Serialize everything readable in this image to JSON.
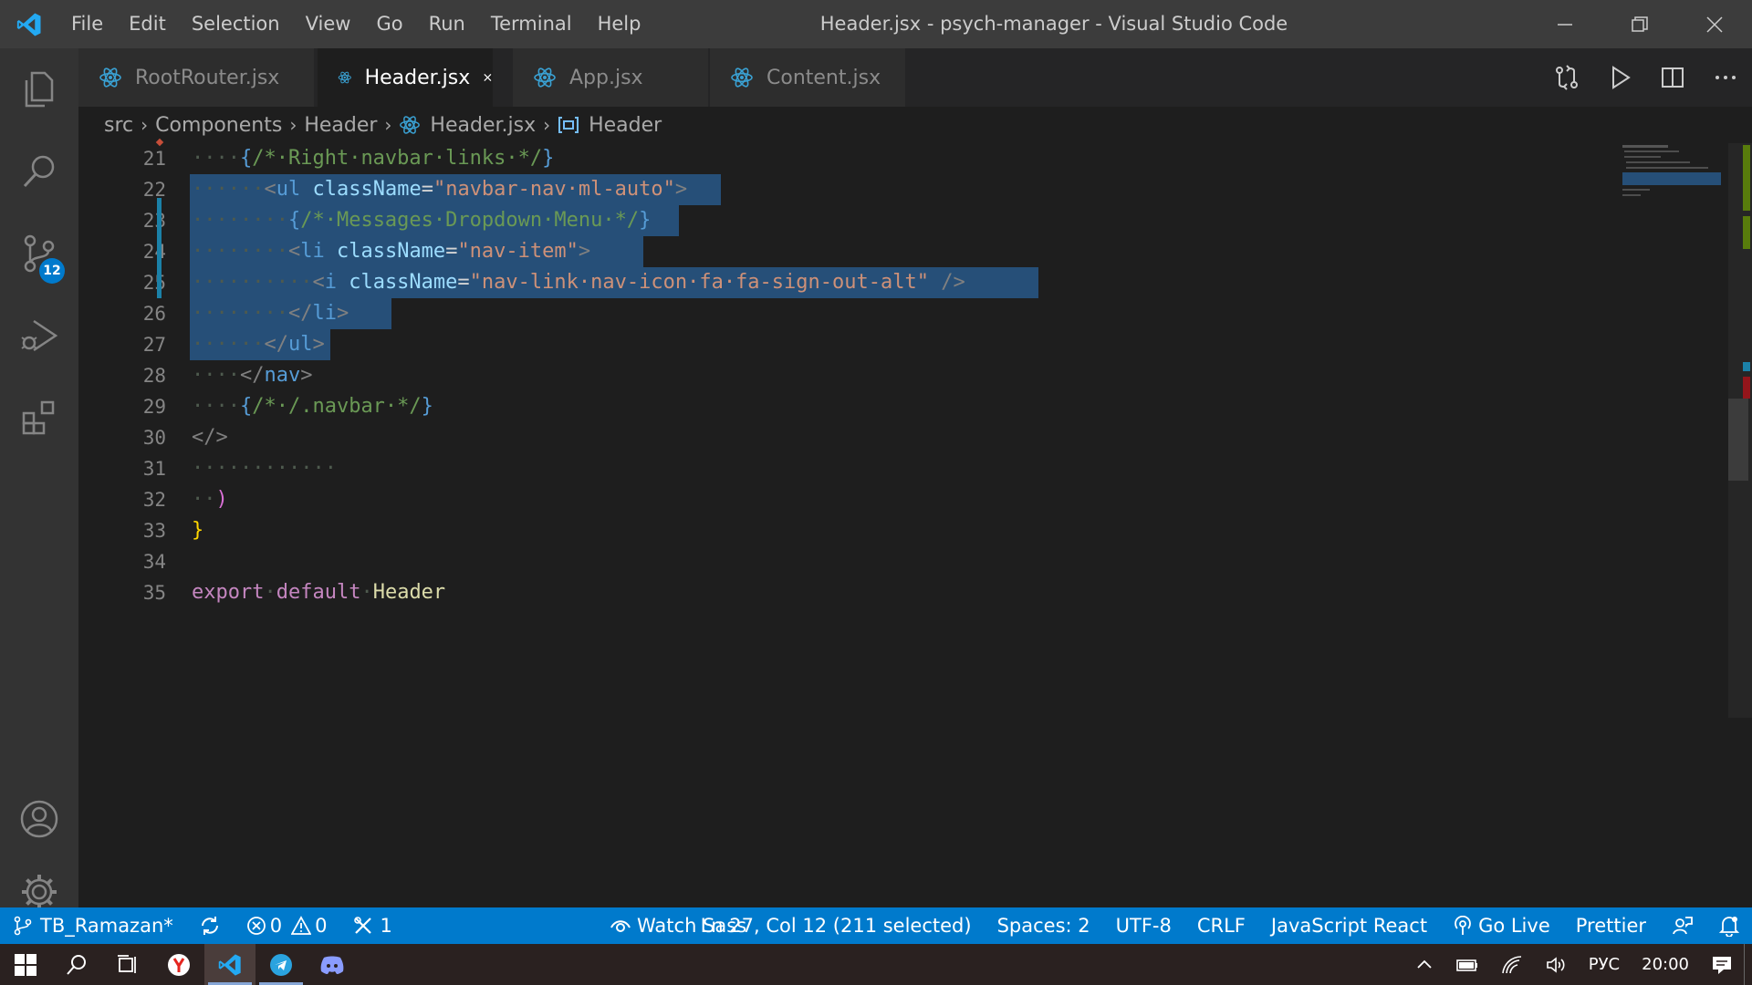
{
  "window": {
    "title": "Header.jsx - psych-manager - Visual Studio Code",
    "menu": [
      "File",
      "Edit",
      "Selection",
      "View",
      "Go",
      "Run",
      "Terminal",
      "Help"
    ]
  },
  "activity_bar": {
    "source_control_badge": "12"
  },
  "tabs": [
    {
      "label": "RootRouter.jsx",
      "active": false
    },
    {
      "label": "Header.jsx",
      "active": true
    },
    {
      "label": "App.jsx",
      "active": false
    },
    {
      "label": "Content.jsx",
      "active": false
    }
  ],
  "breadcrumbs": {
    "items": [
      "src",
      "Components",
      "Header",
      "Header.jsx",
      "Header"
    ]
  },
  "editor": {
    "line_numbers": [
      "21",
      "22",
      "23",
      "24",
      "25",
      "26",
      "27",
      "28",
      "29",
      "30",
      "31",
      "32",
      "33",
      "34",
      "35"
    ]
  },
  "statusbar": {
    "branch": "TB_Ramazan*",
    "errors": "0",
    "warnings": "0",
    "ports": "1",
    "watch_sass": "Watch Sass",
    "cursor": "Ln 27, Col 12 (211 selected)",
    "spaces": "Spaces: 2",
    "encoding": "UTF-8",
    "eol": "CRLF",
    "language": "JavaScript React",
    "go_live": "Go Live",
    "formatter": "Prettier"
  },
  "taskbar": {
    "language": "РУС",
    "time": "20:00"
  },
  "colors": {
    "accent": "#007acc",
    "selection": "#264f78",
    "titlebar": "#3c3c3c",
    "activitybar": "#333333"
  }
}
